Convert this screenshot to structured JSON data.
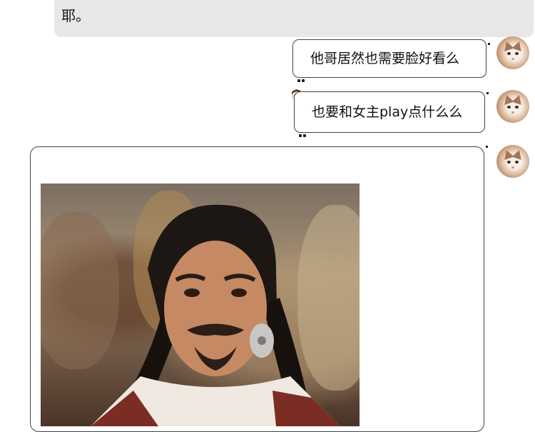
{
  "messages": {
    "incoming_top": {
      "text": "耶。"
    },
    "outgoing": [
      {
        "text": "他哥居然也需要脸好看么"
      },
      {
        "text": "也要和女主play点什么么"
      }
    ]
  },
  "colors": {
    "incoming_bubble": "#e7e7e7",
    "outgoing_border": "#444444",
    "background": "#ffffff"
  },
  "avatar": {
    "icon": "cat-avatar-icon"
  },
  "image_message": {
    "icon": "photo-image",
    "subject": "man with long braided hair"
  }
}
